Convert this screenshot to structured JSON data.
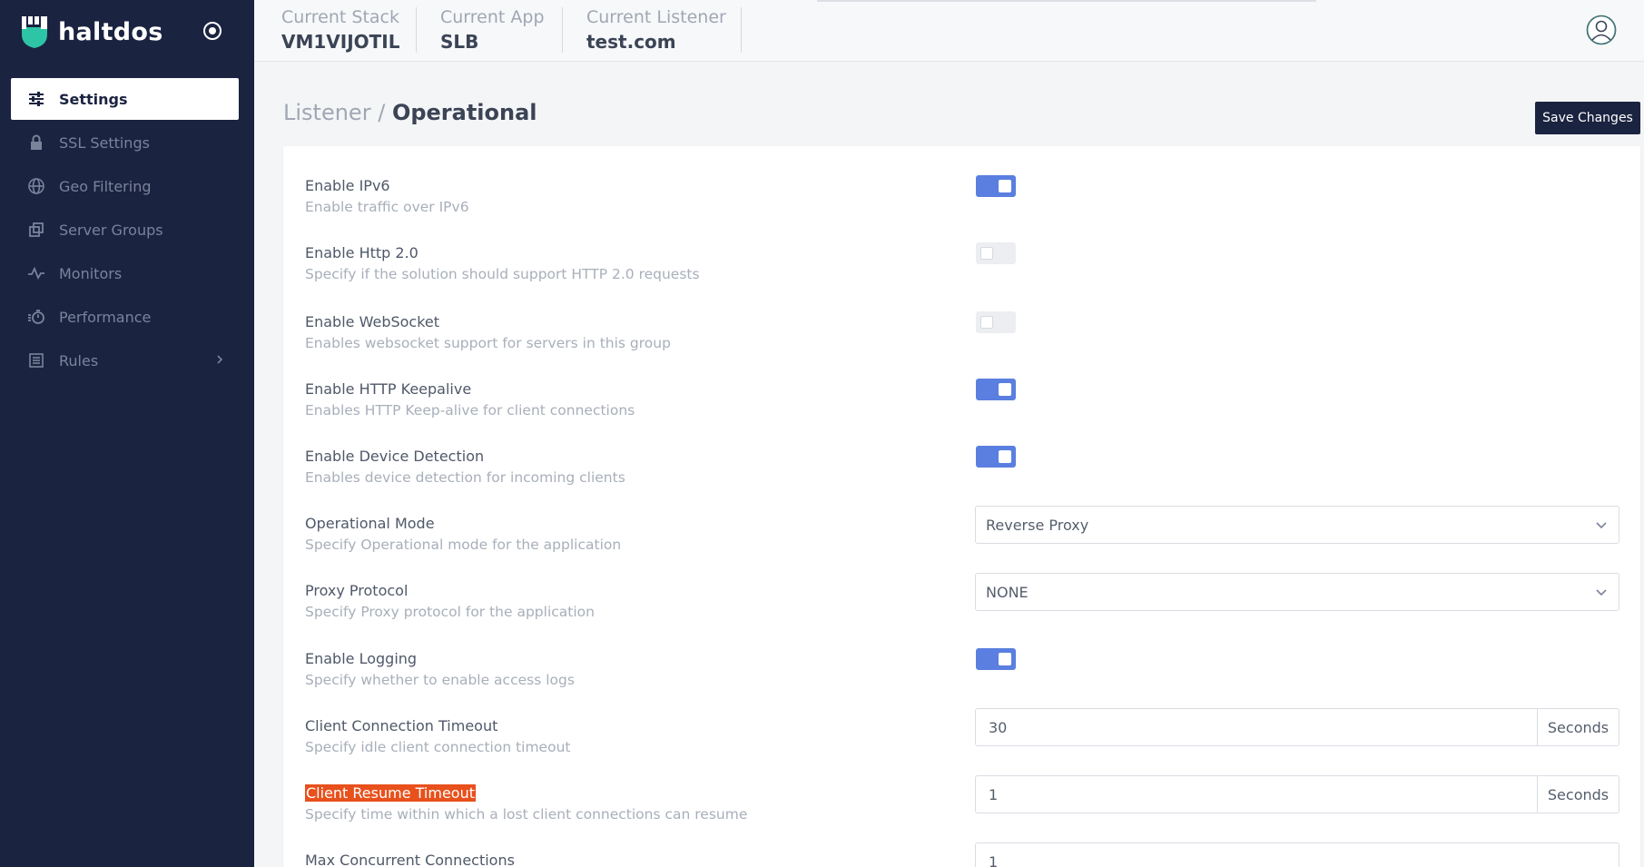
{
  "brand": {
    "name": "haltdos"
  },
  "sidebar": {
    "items": [
      {
        "label": "Settings",
        "icon": "sliders-icon",
        "active": true
      },
      {
        "label": "SSL Settings",
        "icon": "lock-icon"
      },
      {
        "label": "Geo Filtering",
        "icon": "globe-icon"
      },
      {
        "label": "Server Groups",
        "icon": "copy-icon"
      },
      {
        "label": "Monitors",
        "icon": "activity-icon"
      },
      {
        "label": "Performance",
        "icon": "stopwatch-icon"
      },
      {
        "label": "Rules",
        "icon": "list-icon",
        "has_submenu": true
      }
    ]
  },
  "topbar": {
    "stack": {
      "label": "Current Stack",
      "value": "VM1VIJOTIL"
    },
    "app": {
      "label": "Current App",
      "value": "SLB"
    },
    "listener": {
      "label": "Current Listener",
      "value": "test.com"
    }
  },
  "page": {
    "breadcrumb_parent": "Listener",
    "breadcrumb_sep": "/",
    "breadcrumb_current": "Operational",
    "save_label": "Save Changes"
  },
  "settings": [
    {
      "title": "Enable IPv6",
      "desc": "Enable traffic over IPv6",
      "control": "toggle",
      "on": true
    },
    {
      "title": "Enable Http 2.0",
      "desc": "Specify if the solution should support HTTP 2.0 requests",
      "control": "toggle",
      "on": false
    },
    {
      "title": "Enable WebSocket",
      "desc": "Enables websocket support for servers in this group",
      "control": "toggle",
      "on": false
    },
    {
      "title": "Enable HTTP Keepalive",
      "desc": "Enables HTTP Keep-alive for client connections",
      "control": "toggle",
      "on": true
    },
    {
      "title": "Enable Device Detection",
      "desc": "Enables device detection for incoming clients",
      "control": "toggle",
      "on": true
    },
    {
      "title": "Operational Mode",
      "desc": "Specify Operational mode for the application",
      "control": "select",
      "value": "Reverse Proxy"
    },
    {
      "title": "Proxy Protocol",
      "desc": "Specify Proxy protocol for the application",
      "control": "select",
      "value": "NONE"
    },
    {
      "title": "Enable Logging",
      "desc": "Specify whether to enable access logs",
      "control": "toggle",
      "on": true
    },
    {
      "title": "Client Connection Timeout",
      "desc": "Specify idle client connection timeout",
      "control": "input",
      "value": "30",
      "unit": "Seconds"
    },
    {
      "title": "Client Resume Timeout",
      "desc": "Specify time within which a lost client connections can resume",
      "control": "input",
      "value": "1",
      "unit": "Seconds",
      "highlighted": true
    },
    {
      "title": "Max Concurrent Connections",
      "desc": "",
      "control": "input",
      "value": "1",
      "unit": ""
    }
  ],
  "colors": {
    "sidebar_bg": "#1a2340",
    "toggle_on": "#5a7fe0",
    "highlight": "#e8501c",
    "brand_teal": "#2ec4a6"
  }
}
